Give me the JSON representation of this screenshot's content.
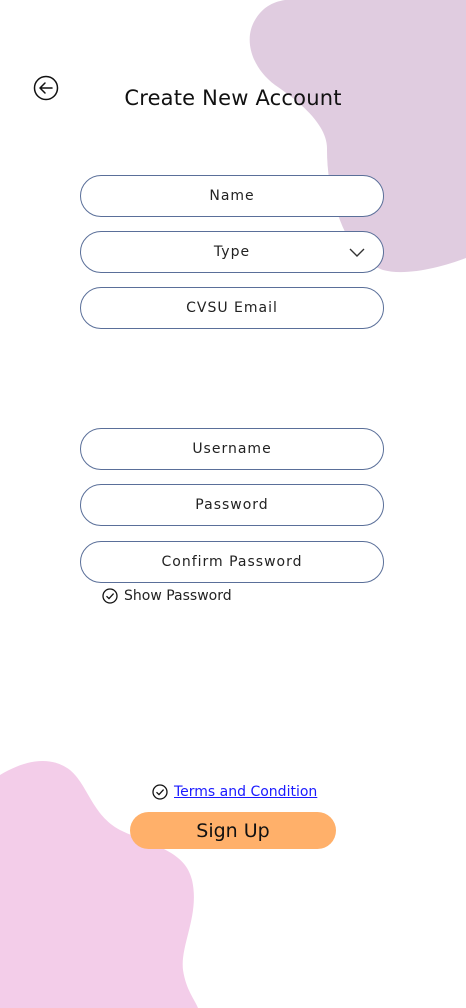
{
  "header": {
    "back_icon": "back-arrow-icon",
    "title": "Create New Account"
  },
  "form": {
    "name_placeholder": "Name",
    "type_placeholder": "Type",
    "email_placeholder": "CVSU Email",
    "username_placeholder": "Username",
    "password_placeholder": "Password",
    "confirm_password_placeholder": "Confirm Password",
    "show_password_label": "Show Password"
  },
  "footer": {
    "terms_label": "Terms and Condition",
    "signup_label": "Sign Up"
  },
  "colors": {
    "top_blob": "#e0cce0",
    "bottom_blob": "#f3cde9",
    "field_border": "#5a6f99",
    "signup_button": "#ffb06a",
    "link": "#1a1aff"
  }
}
